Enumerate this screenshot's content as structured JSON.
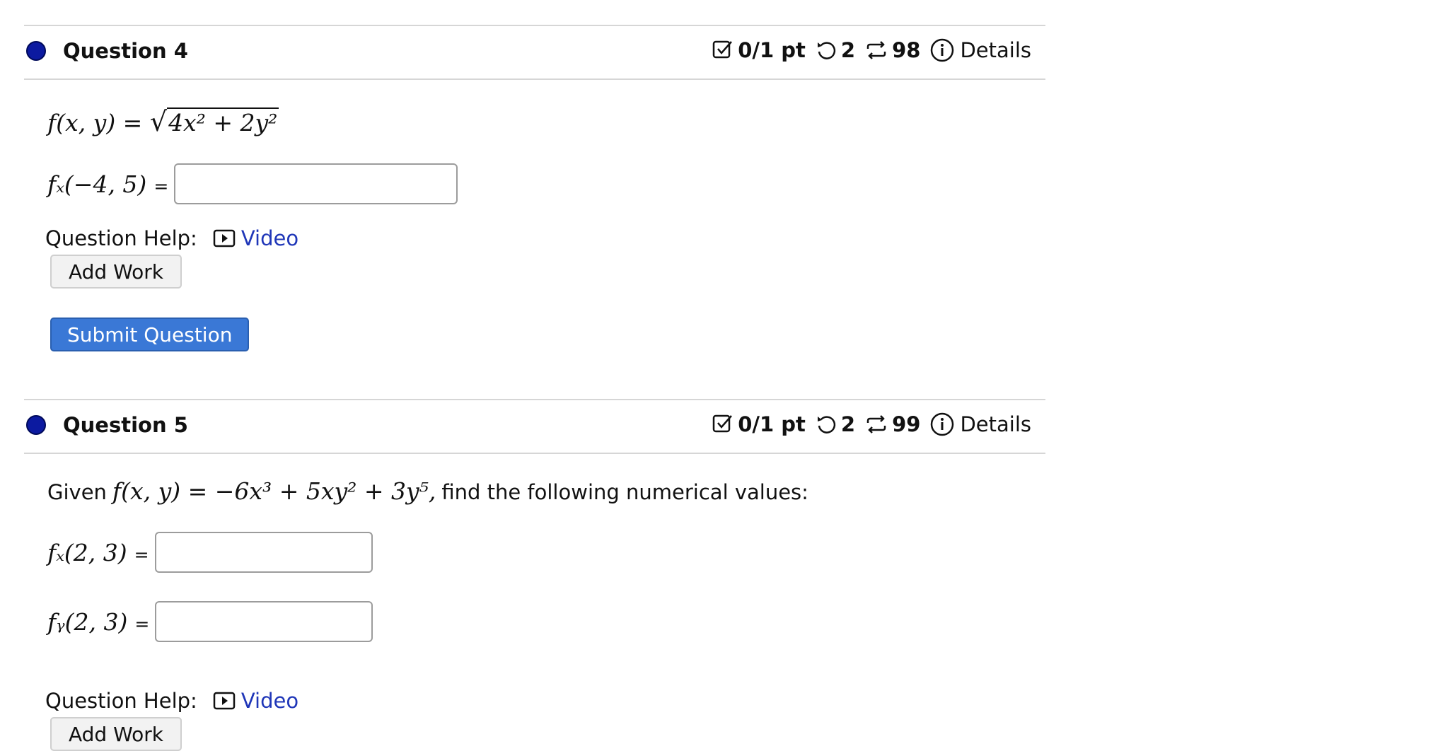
{
  "question4": {
    "title": "Question 4",
    "score": "0/1 pt",
    "retries": "2",
    "attempts": "98",
    "details": "Details",
    "function_lhs": "f(x, y) =",
    "function_radicand": "4x² + 2y²",
    "answer_label": "fₓ(−4, 5)",
    "answer_value": "",
    "help_label": "Question Help:",
    "video_label": "Video",
    "add_work_label": "Add Work",
    "submit_label": "Submit Question"
  },
  "question5": {
    "title": "Question 5",
    "score": "0/1 pt",
    "retries": "2",
    "attempts": "99",
    "details": "Details",
    "given_prefix": "Given",
    "given_expr": "f(x, y) = −6x³ + 5xy² + 3y⁵,",
    "given_suffix": "find the following numerical values:",
    "answer1_label": "fₓ(2, 3)",
    "answer1_value": "",
    "answer2_label": "fᵧ(2, 3)",
    "answer2_value": "",
    "help_label": "Question Help:",
    "video_label": "Video",
    "add_work_label": "Add Work"
  },
  "equals_sign": "=",
  "icons": {
    "status_dot": "status-dot-icon",
    "score": "checkbox-icon",
    "retries": "retry-icon",
    "attempts": "attempts-icon",
    "details": "info-icon",
    "video": "video-play-icon"
  },
  "colors": {
    "dot": "#0c1aa0",
    "link": "#1f36b8",
    "submit": "#3a78d6",
    "divider": "#d6d6d6"
  }
}
